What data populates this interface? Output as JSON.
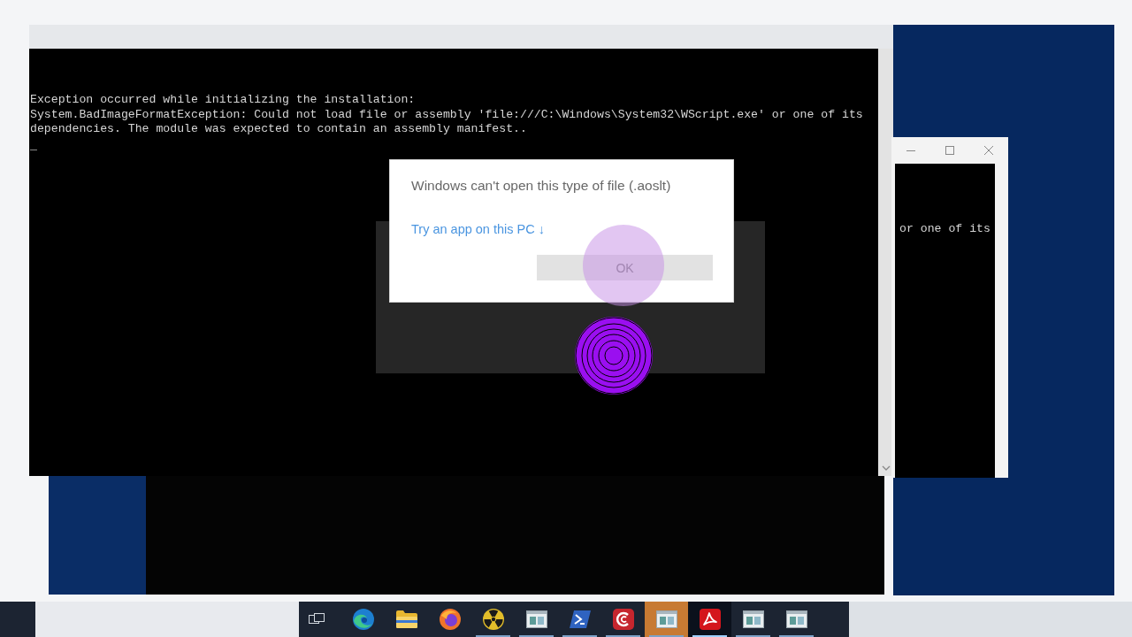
{
  "console_window": {
    "lines": [
      "Exception occurred while initializing the installation:",
      "System.BadImageFormatException: Could not load file or assembly 'file:///C:\\Windows\\System32\\WScript.exe' or one of its",
      "dependencies. The module was expected to contain an assembly manifest.."
    ],
    "cursor": "_"
  },
  "second_console_window": {
    "lines": [
      "or one of its"
    ]
  },
  "dialog": {
    "title": "Windows can't open this type of file (.aoslt)",
    "link": "Try an app on this PC ↓",
    "button": "OK"
  },
  "taskbar": {
    "apps": [
      {
        "kind": "swirl",
        "running": false,
        "selected": false,
        "flashing": false
      },
      {
        "kind": "folder",
        "running": false,
        "selected": false,
        "flashing": false
      },
      {
        "kind": "fox",
        "running": false,
        "selected": false,
        "flashing": false
      },
      {
        "kind": "radiation",
        "running": true,
        "selected": false,
        "flashing": false
      },
      {
        "kind": "window",
        "running": true,
        "selected": false,
        "flashing": false
      },
      {
        "kind": "terminal",
        "running": true,
        "selected": false,
        "flashing": false
      },
      {
        "kind": "c-logo",
        "running": true,
        "selected": false,
        "flashing": false
      },
      {
        "kind": "window",
        "running": true,
        "selected": false,
        "flashing": true
      },
      {
        "kind": "pdf",
        "running": true,
        "selected": true,
        "flashing": false
      },
      {
        "kind": "window",
        "running": true,
        "selected": false,
        "flashing": false
      },
      {
        "kind": "window",
        "running": true,
        "selected": false,
        "flashing": false
      }
    ]
  }
}
